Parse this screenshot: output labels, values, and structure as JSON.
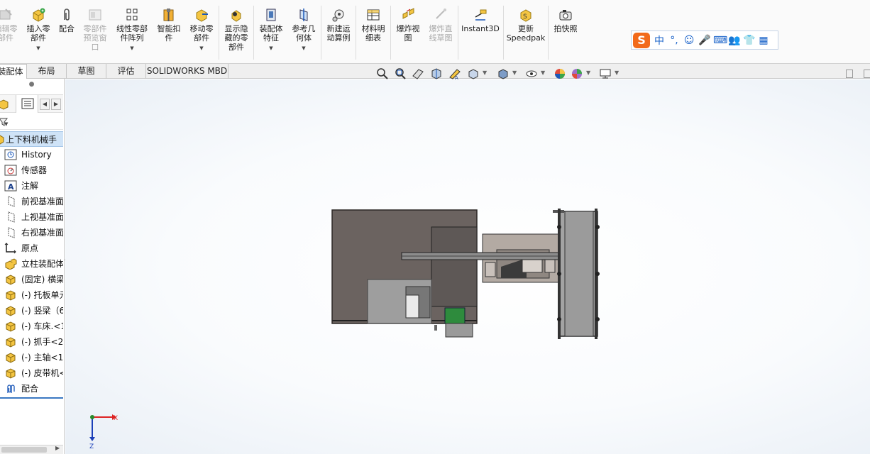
{
  "ribbon": {
    "buttons": [
      {
        "id": "edit-component",
        "label": "编辑零\n部件",
        "disabled": true
      },
      {
        "id": "insert-component",
        "label": "插入零\n部件",
        "disabled": false,
        "dropdown": true
      },
      {
        "id": "mate",
        "label": "配合",
        "disabled": false
      },
      {
        "id": "component-preview",
        "label": "零部件\n预览窗\n口",
        "disabled": true
      },
      {
        "id": "linear-pattern",
        "label": "线性零部\n件阵列",
        "disabled": false,
        "dropdown": true
      },
      {
        "id": "smart-fasteners",
        "label": "智能扣\n件",
        "disabled": false
      },
      {
        "id": "move-component",
        "label": "移动零\n部件",
        "disabled": false,
        "dropdown": true
      },
      {
        "id": "show-hidden",
        "label": "显示隐\n藏的零\n部件",
        "disabled": false
      },
      {
        "id": "assembly-features",
        "label": "装配体\n特征",
        "disabled": false,
        "dropdown": true
      },
      {
        "id": "reference-geometry",
        "label": "参考几\n何体",
        "disabled": false,
        "dropdown": true
      },
      {
        "id": "new-motion-study",
        "label": "新建运\n动算例",
        "disabled": false
      },
      {
        "id": "bill-of-materials",
        "label": "材料明\n细表",
        "disabled": false
      },
      {
        "id": "exploded-view",
        "label": "爆炸视\n图",
        "disabled": false
      },
      {
        "id": "explode-line-sketch",
        "label": "爆炸直\n线草图",
        "disabled": true
      },
      {
        "id": "instant3d",
        "label": "Instant3D",
        "disabled": false
      },
      {
        "id": "update-speedpak",
        "label": "更新\nSpeedpak",
        "disabled": false
      },
      {
        "id": "take-snapshot",
        "label": "拍快照",
        "disabled": false
      }
    ]
  },
  "ime": {
    "logo": "S",
    "items": [
      "中",
      "°,",
      "☺",
      "🎤",
      "⌨",
      "👥",
      "👕",
      "▦"
    ]
  },
  "tabs": [
    "装配体",
    "布局",
    "草图",
    "评估",
    "SOLIDWORKS MBD"
  ],
  "tabs_active": "装配体",
  "tree": {
    "root": "上下料机械手",
    "items": [
      {
        "label": "History",
        "icon": "history-icon"
      },
      {
        "label": "传感器",
        "icon": "sensor-icon"
      },
      {
        "label": "注解",
        "icon": "annotation-icon"
      },
      {
        "label": "前视基准面",
        "icon": "plane-icon"
      },
      {
        "label": "上视基准面",
        "icon": "plane-icon"
      },
      {
        "label": "右视基准面",
        "icon": "plane-icon"
      },
      {
        "label": "原点",
        "icon": "origin-icon"
      },
      {
        "label": "立柱装配体",
        "icon": "subassembly-icon"
      },
      {
        "label": "(固定) 横梁",
        "icon": "part-icon"
      },
      {
        "label": "(-) 托板单元",
        "icon": "part-icon"
      },
      {
        "label": "(-) 竖梁（6",
        "icon": "part-icon"
      },
      {
        "label": "(-) 车床.<1",
        "icon": "part-icon"
      },
      {
        "label": "(-) 抓手<2",
        "icon": "part-icon"
      },
      {
        "label": "(-) 主轴<1",
        "icon": "part-icon"
      },
      {
        "label": "(-) 皮带机<",
        "icon": "part-icon"
      },
      {
        "label": "配合",
        "icon": "mates-icon"
      }
    ]
  },
  "triad": {
    "x_label": "X",
    "z_label": "Z"
  },
  "colors": {
    "accent": "#3a78c2",
    "selection": "#cfe3f7",
    "lathe_body": "#6b6360",
    "machine_gray": "#9b9b9b",
    "green_part": "#2e8b3d"
  }
}
